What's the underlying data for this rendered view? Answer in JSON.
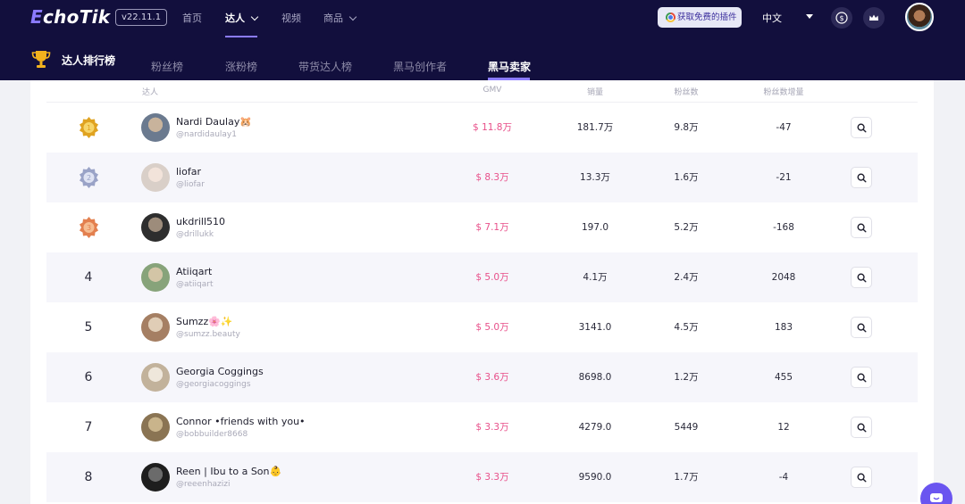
{
  "app": {
    "logo": "EchoTik",
    "version": "v22.11.1"
  },
  "topnav": {
    "items": [
      {
        "label": "首页"
      },
      {
        "label": "达人"
      },
      {
        "label": "视频"
      },
      {
        "label": "商品"
      }
    ],
    "plugin_button": "获取免费的插件",
    "language": "中文"
  },
  "subnav": {
    "title": "达人排行榜",
    "tabs": [
      {
        "label": "粉丝榜"
      },
      {
        "label": "涨粉榜"
      },
      {
        "label": "带货达人榜"
      },
      {
        "label": "黑马创作者"
      },
      {
        "label": "黑马卖家"
      }
    ],
    "active_tab": "黑马卖家"
  },
  "table": {
    "headers": {
      "influencer": "达人",
      "gmv": "GMV",
      "sales": "销量",
      "followers": "粉丝数",
      "follower_growth": "粉丝数增量"
    },
    "rows": [
      {
        "rank": "1",
        "medal": "gold",
        "name": "Nardi Daulay🐹",
        "handle": "@nardidaulay1",
        "gmv": "$ 11.8万",
        "sales": "181.7万",
        "followers": "9.8万",
        "growth": "-47"
      },
      {
        "rank": "2",
        "medal": "silver",
        "name": "liofar",
        "handle": "@liofar",
        "gmv": "$ 8.3万",
        "sales": "13.3万",
        "followers": "1.6万",
        "growth": "-21"
      },
      {
        "rank": "3",
        "medal": "bronze",
        "name": "ukdrill510",
        "handle": "@drillukk",
        "gmv": "$ 7.1万",
        "sales": "197.0",
        "followers": "5.2万",
        "growth": "-168"
      },
      {
        "rank": "4",
        "name": "Atiiqart",
        "handle": "@atiiqart",
        "gmv": "$ 5.0万",
        "sales": "4.1万",
        "followers": "2.4万",
        "growth": "2048"
      },
      {
        "rank": "5",
        "name": "Sumzz🌸✨",
        "handle": "@sumzz.beauty",
        "gmv": "$ 5.0万",
        "sales": "3141.0",
        "followers": "4.5万",
        "growth": "183"
      },
      {
        "rank": "6",
        "name": "Georgia Coggings",
        "handle": "@georgiacoggings",
        "gmv": "$ 3.6万",
        "sales": "8698.0",
        "followers": "1.2万",
        "growth": "455"
      },
      {
        "rank": "7",
        "name": "Connor •friends with you•",
        "handle": "@bobbuilder8668",
        "gmv": "$ 3.3万",
        "sales": "4279.0",
        "followers": "5449",
        "growth": "12"
      },
      {
        "rank": "8",
        "name": "Reen | Ibu to a Son👶",
        "handle": "@reeenhazizi",
        "gmv": "$ 3.3万",
        "sales": "9590.0",
        "followers": "1.7万",
        "growth": "-4"
      }
    ]
  },
  "icons": {
    "plugin": "chrome-icon",
    "currency": "dollar-icon",
    "vip": "crown-icon",
    "trophy": "trophy-icon",
    "row_action": "search-icon",
    "chat": "chat-icon"
  },
  "colors": {
    "header_bg": "#120f3d",
    "accent": "#8b7bff",
    "gmv": "#e8508a",
    "gold": "#e0a321",
    "silver": "#9aa3c7",
    "bronze": "#e3804f"
  }
}
